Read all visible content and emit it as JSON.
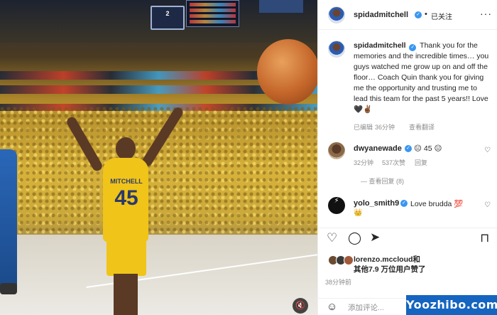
{
  "media": {
    "scoreboard_text": "2",
    "jersey_name": "MITCHELL",
    "jersey_number": "45",
    "mute_icon": "speaker-muted-icon"
  },
  "post": {
    "author": "spidadmitchell",
    "follow_status": "已关注",
    "separator": "•",
    "caption_author": "spidadmitchell",
    "caption": "Thank you for the memories and the incredible times… you guys watched me grow up on and off the floor… Coach Quin thank you for giving me the opportunity and trusting me to lead this team for the past 5 years!! Love 🖤✌🏾",
    "caption_meta_edited": "已编辑",
    "caption_meta_time": "36分钟",
    "caption_meta_translate": "查看翻译"
  },
  "comments": [
    {
      "user": "dwyanewade",
      "text": "😐 45 😐",
      "time": "32分钟",
      "likes": "537次赞",
      "reply": "回复",
      "view_replies": "查看回复 (8)"
    },
    {
      "user": "yolo_smith9",
      "text": "Love brudda 💯",
      "badge": "👑"
    }
  ],
  "actions": {
    "like_icon": "heart-icon",
    "comment_icon": "comment-icon",
    "share_icon": "share-icon",
    "save_icon": "bookmark-icon"
  },
  "likes_line1": "lorenzo.mccloud和",
  "likes_line2": "其他7.9 万位用户赞了",
  "timestamp": "38分钟前",
  "add_comment_placeholder": "添加评论...",
  "watermark": "Yoozhibo.com",
  "colors": {
    "verified": "#3897f0",
    "highlight_border": "#e03a3a",
    "watermark_bg": "#1565c0"
  }
}
